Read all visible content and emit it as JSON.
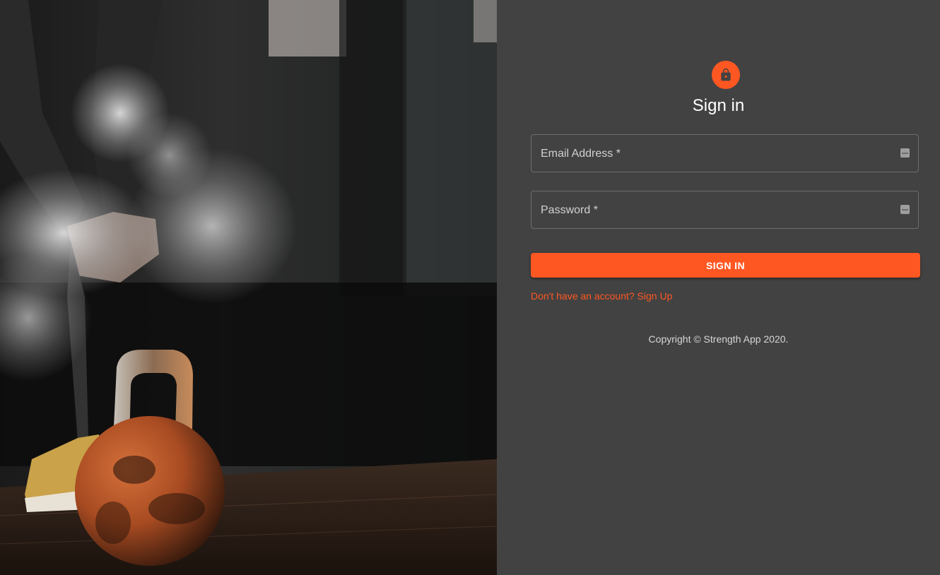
{
  "hero": {
    "image_description_icon": "kettlebell-photo"
  },
  "signin": {
    "icon": "lock-icon",
    "title": "Sign in",
    "email_label": "Email Address *",
    "email_value": "",
    "password_label": "Password *",
    "password_value": "",
    "field_icon": "keyboard-dots-icon",
    "submit_label": "SIGN IN",
    "signup_link": "Don't have an account? Sign Up",
    "copyright": "Copyright © Strength App 2020."
  },
  "colors": {
    "accent": "#ff5722",
    "panel_background": "#424242",
    "text_primary": "#ffffff"
  }
}
